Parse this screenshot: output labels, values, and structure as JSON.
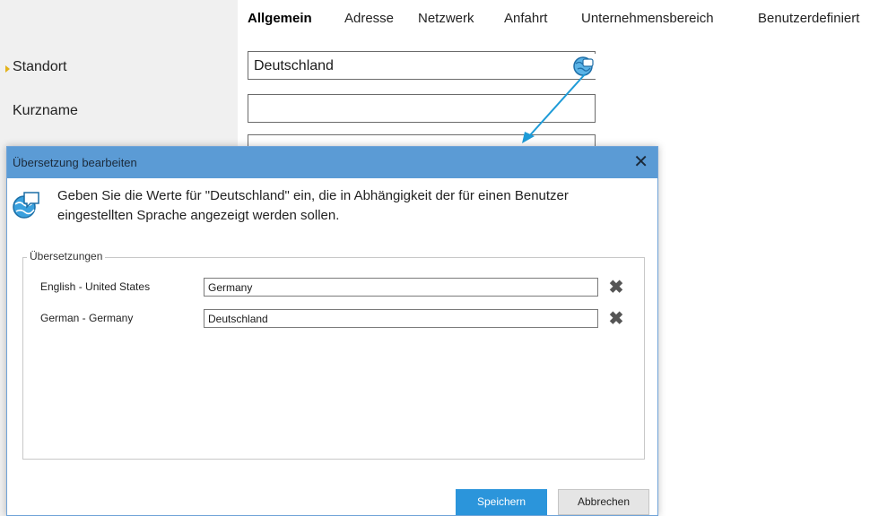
{
  "tabs": [
    "Allgemein",
    "Adresse",
    "Netzwerk",
    "Anfahrt",
    "Unternehmensbereich",
    "Benutzerdefiniert"
  ],
  "form": {
    "standort_label": "Standort",
    "standort_value": "Deutschland",
    "kurzname_label": "Kurzname",
    "kurzname_value": ""
  },
  "dialog": {
    "title": "Übersetzung bearbeiten",
    "close_glyph": "✕",
    "message": "Geben Sie die Werte für \"Deutschland\" ein, die in Abhängigkeit der für einen Benutzer eingestellten Sprache angezeigt werden sollen.",
    "group_title": "Übersetzungen",
    "translations": [
      {
        "language": "English - United States",
        "value": "Germany"
      },
      {
        "language": "German - Germany",
        "value": "Deutschland"
      }
    ],
    "delete_glyph": "✖",
    "save_label": "Speichern",
    "cancel_label": "Abbrechen"
  },
  "icons": {
    "translate": "globe-speech-icon",
    "delete": "delete-x-icon",
    "close": "close-icon"
  },
  "colors": {
    "dialog_titlebar": "#5b9bd5",
    "primary_button": "#2b95db",
    "arrow": "#1e9bd7",
    "row_marker": "#e3b21a"
  }
}
